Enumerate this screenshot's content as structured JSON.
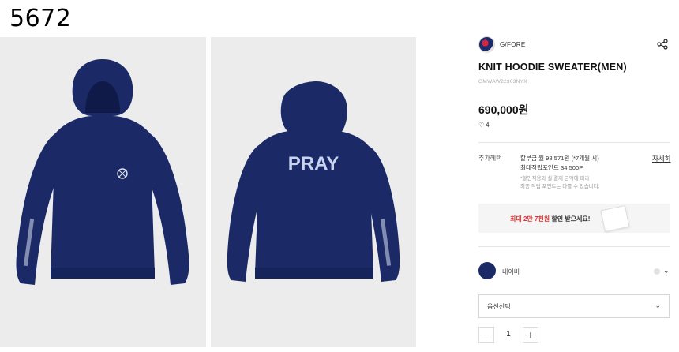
{
  "corner_id": "5672",
  "brand": {
    "name": "G/FORE"
  },
  "product": {
    "title": "KNIT HOODIE SWEATER(MEN)",
    "sku": "GMWAW22303NYX",
    "price": "690,000원",
    "likes": "4"
  },
  "benefits": {
    "label": "추가혜택",
    "line1": "할부금 월 98,571원 (*7개월 시)",
    "line2": "최대적립포인트 34,500P",
    "note1": "*할인적용과 실 결제 금액에 따라",
    "note2": "최종 적립 포인트는 다를 수 있습니다.",
    "detail_link": "자세히"
  },
  "coupon": {
    "prefix": "최대 2만 7천원",
    "suffix": " 할인 받으세요!"
  },
  "color_option": {
    "label": "네이비",
    "swatch_color": "#1b2a66"
  },
  "option_select": {
    "label": "옵션선택"
  },
  "quantity": {
    "minus": "−",
    "value": "1",
    "plus": "+"
  },
  "images": {
    "back_print": "PRAY"
  },
  "colors": {
    "navy": "#1b2a66",
    "photo_bg": "#ececec",
    "accent_red": "#e0322f"
  }
}
